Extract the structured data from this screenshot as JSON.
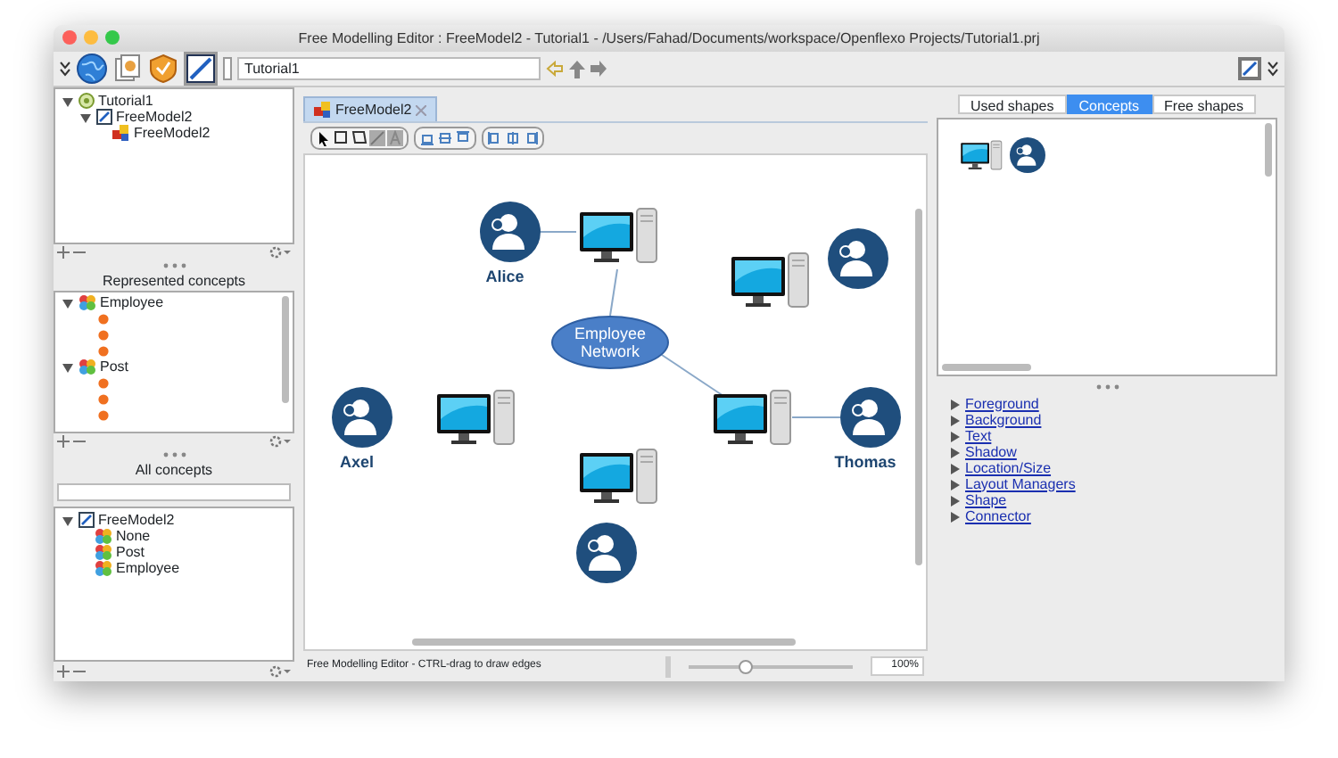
{
  "window": {
    "title": "Free Modelling Editor : FreeModel2 - Tutorial1 - /Users/Fahad/Documents/workspace/Openflexo Projects/Tutorial1.prj"
  },
  "toolbar": {
    "project_field": "Tutorial1"
  },
  "project_tree": [
    {
      "kind": "project",
      "label": "Tutorial1",
      "expanded": true,
      "children": [
        {
          "kind": "model",
          "label": "FreeModel2",
          "expanded": true,
          "children": [
            {
              "kind": "diagram",
              "label": "FreeModel2"
            }
          ]
        }
      ]
    }
  ],
  "represented_concepts": {
    "title": "Represented concepts",
    "items": [
      {
        "kind": "concept",
        "label": "Employee",
        "expanded": true,
        "children": [
          {
            "kind": "instance"
          },
          {
            "kind": "instance"
          },
          {
            "kind": "instance"
          }
        ]
      },
      {
        "kind": "concept",
        "label": "Post",
        "expanded": true,
        "children": [
          {
            "kind": "instance"
          },
          {
            "kind": "instance"
          },
          {
            "kind": "instance"
          }
        ]
      }
    ]
  },
  "all_concepts": {
    "title": "All concepts",
    "items": [
      {
        "kind": "model",
        "label": "FreeModel2",
        "expanded": true,
        "children": [
          {
            "kind": "concept",
            "label": "None"
          },
          {
            "kind": "concept",
            "label": "Post"
          },
          {
            "kind": "concept",
            "label": "Employee"
          }
        ]
      }
    ]
  },
  "editor_tab": {
    "label": "FreeModel2"
  },
  "diagram": {
    "nodes": [
      {
        "kind": "person",
        "label": "Alice"
      },
      {
        "kind": "computer"
      },
      {
        "kind": "computer"
      },
      {
        "kind": "person"
      },
      {
        "kind": "concept",
        "label": "Employee Network"
      },
      {
        "kind": "person",
        "label": "Axel"
      },
      {
        "kind": "computer"
      },
      {
        "kind": "computer"
      },
      {
        "kind": "person",
        "label": "Thomas"
      },
      {
        "kind": "computer"
      },
      {
        "kind": "person"
      }
    ]
  },
  "status_bar": {
    "text": "Free Modelling Editor - CTRL-drag to draw edges",
    "zoom": {
      "level": 0.35,
      "reading": "100%"
    }
  },
  "palette": {
    "tabs": [
      {
        "label": "Used shapes",
        "selected": false
      },
      {
        "label": "Concepts",
        "selected": true
      },
      {
        "label": "Free shapes",
        "selected": false
      }
    ],
    "items": [
      {
        "kind": "computer"
      },
      {
        "kind": "person"
      }
    ]
  },
  "properties": [
    {
      "label": "Foreground",
      "expanded": false
    },
    {
      "label": "Background",
      "expanded": false
    },
    {
      "label": "Text",
      "expanded": false
    },
    {
      "label": "Shadow",
      "expanded": false
    },
    {
      "label": "Location/Size",
      "expanded": false
    },
    {
      "label": "Layout Managers",
      "expanded": false
    },
    {
      "label": "Shape",
      "expanded": false
    },
    {
      "label": "Connector",
      "expanded": false
    }
  ]
}
